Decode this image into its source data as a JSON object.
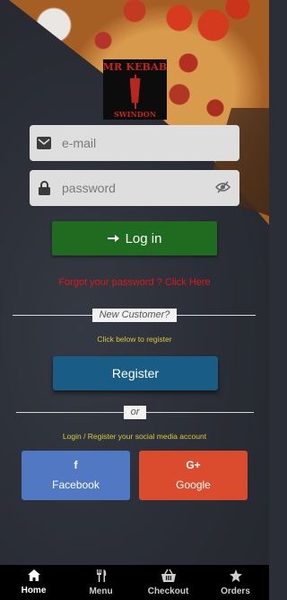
{
  "brand": {
    "logo_top": "MR KEBAB",
    "logo_bottom": "SWINDON"
  },
  "login": {
    "email_placeholder": "e-mail",
    "password_placeholder": "password",
    "login_label": "Log in",
    "forgot_text": "Forgot your password ? Click Here"
  },
  "register": {
    "new_customer": "New Customer?",
    "hint": "Click below to register",
    "button_label": "Register"
  },
  "social": {
    "or_text": "or",
    "hint": "Login / Register your social media account",
    "facebook_label": "Facebook",
    "google_label": "Google"
  },
  "nav": {
    "items": [
      {
        "label": "Home",
        "icon": "home-icon",
        "active": true
      },
      {
        "label": "Menu",
        "icon": "fork-knife-icon",
        "active": false
      },
      {
        "label": "Checkout",
        "icon": "basket-icon",
        "active": false
      },
      {
        "label": "Orders",
        "icon": "star-icon",
        "active": false
      }
    ]
  },
  "colors": {
    "login_green": "#1f6b1f",
    "register_blue": "#195d86",
    "facebook": "#5078c3",
    "google": "#db4b2e",
    "forgot_red": "#e0161b",
    "hint_yellow": "#d6c93a"
  }
}
